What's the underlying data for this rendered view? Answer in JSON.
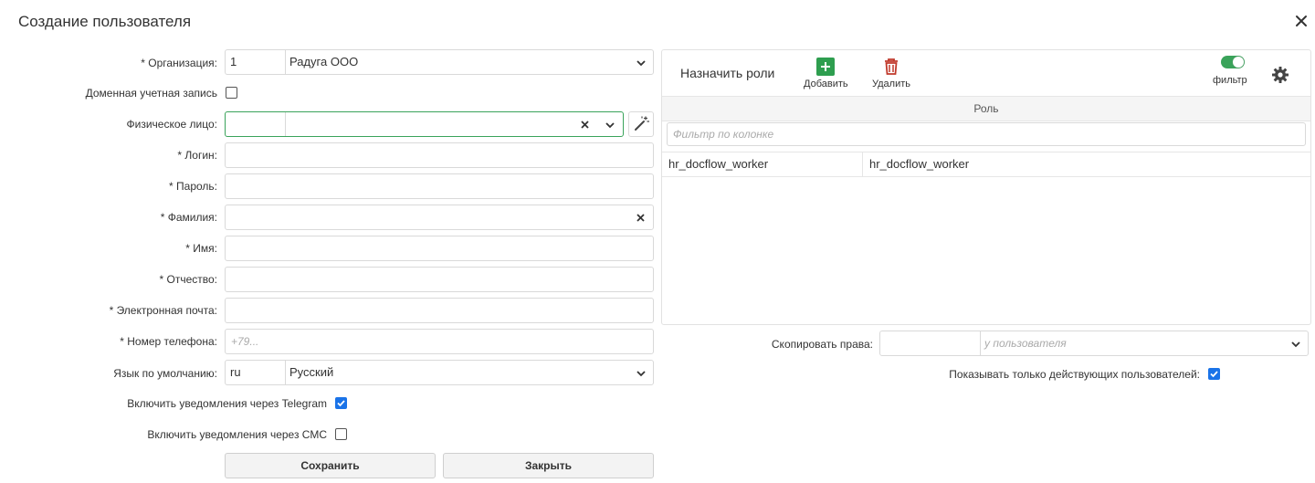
{
  "dialog": {
    "title": "Создание пользователя"
  },
  "form": {
    "organization": {
      "label": "* Организация:",
      "code": "1",
      "name": "Радуга ООО"
    },
    "domain_account": {
      "label": "Доменная учетная запись",
      "checked": false
    },
    "person": {
      "label": "Физическое лицо:",
      "code": "",
      "name": ""
    },
    "login": {
      "label": "* Логин:",
      "value": ""
    },
    "password": {
      "label": "* Пароль:",
      "value": ""
    },
    "last_name": {
      "label": "* Фамилия:",
      "value": ""
    },
    "first_name": {
      "label": "* Имя:",
      "value": ""
    },
    "middle_name": {
      "label": "* Отчество:",
      "value": ""
    },
    "email": {
      "label": "* Электронная почта:",
      "value": ""
    },
    "phone": {
      "label": "* Номер телефона:",
      "placeholder": "+79..."
    },
    "language": {
      "label": "Язык по умолчанию:",
      "code": "ru",
      "name": "Русский"
    },
    "telegram": {
      "label": "Включить уведомления через Telegram",
      "checked": true
    },
    "sms": {
      "label": "Включить уведомления через СМС",
      "checked": false
    }
  },
  "buttons": {
    "save": "Сохранить",
    "close": "Закрыть"
  },
  "roles": {
    "title": "Назначить роли",
    "add_label": "Добавить",
    "delete_label": "Удалить",
    "filter_label": "фильтр",
    "filter_toggle_on": true,
    "column_header": "Роль",
    "filter_placeholder": "Фильтр по колонке",
    "rows": [
      {
        "code": "hr_docflow_worker",
        "name": "hr_docflow_worker"
      }
    ]
  },
  "copy_rights": {
    "label": "Скопировать права:",
    "code": "",
    "placeholder": "у пользователя"
  },
  "active_only": {
    "label": "Показывать только действующих пользователей:",
    "checked": true
  },
  "colors": {
    "accent_green": "#3aa35a",
    "add_green": "#2e9e4f",
    "delete_red": "#c0392b",
    "checkbox_blue": "#1a73e8"
  }
}
